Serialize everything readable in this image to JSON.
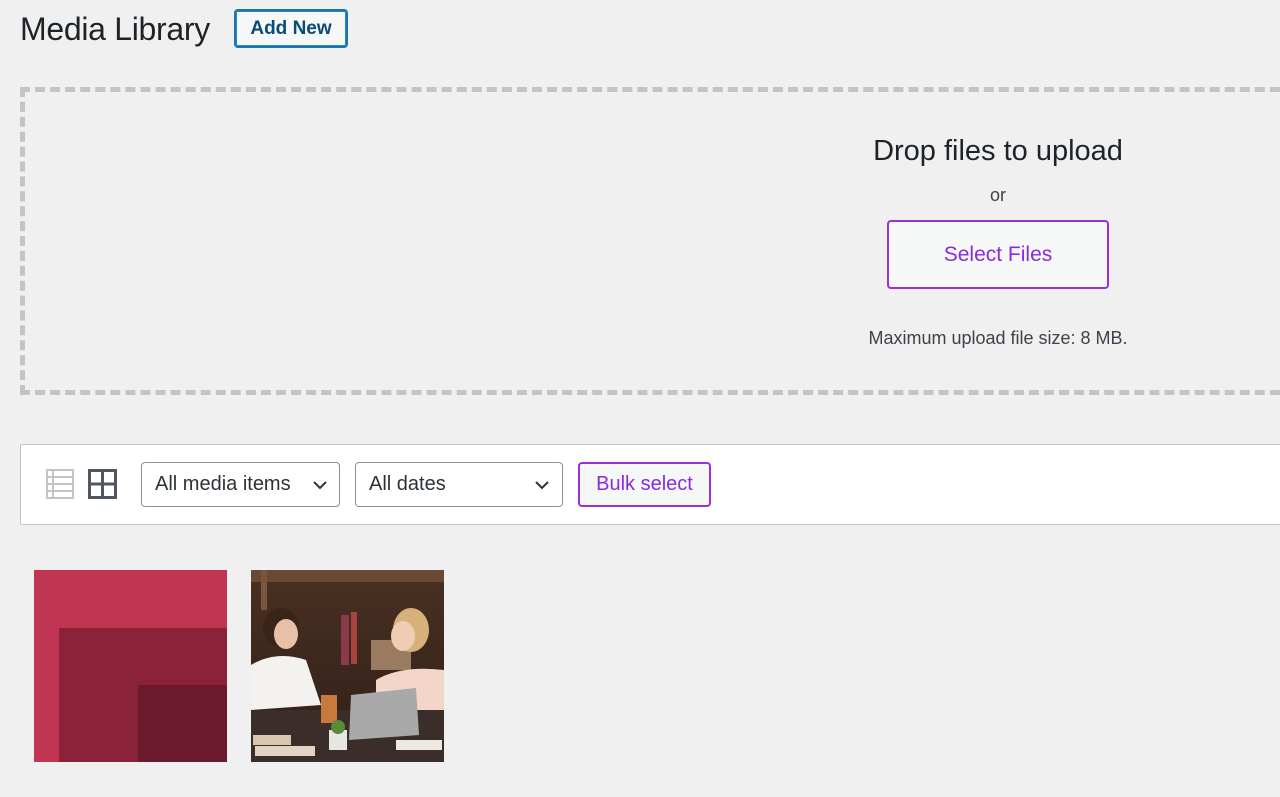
{
  "header": {
    "title": "Media Library",
    "add_new_label": "Add New"
  },
  "uploader": {
    "title": "Drop files to upload",
    "or_text": "or",
    "select_files_label": "Select Files",
    "max_size_text": "Maximum upload file size: 8 MB."
  },
  "toolbar": {
    "view_modes": [
      {
        "name": "list",
        "icon": "list-view-icon",
        "active": false
      },
      {
        "name": "grid",
        "icon": "grid-view-icon",
        "active": true
      }
    ],
    "media_filter": {
      "selected": "All media items"
    },
    "date_filter": {
      "selected": "All dates"
    },
    "bulk_select_label": "Bulk select"
  },
  "media_items": [
    {
      "type": "image",
      "description": "Red nested squares graphic",
      "colors": [
        "#c03551",
        "#8a2339",
        "#6b1b2d"
      ]
    },
    {
      "type": "image",
      "description": "Two women talking at a table with a laptop in a library"
    }
  ],
  "colors": {
    "accent_purple": "#8a2be2",
    "primary_blue": "#2271b1",
    "background": "#f0f0f1"
  }
}
